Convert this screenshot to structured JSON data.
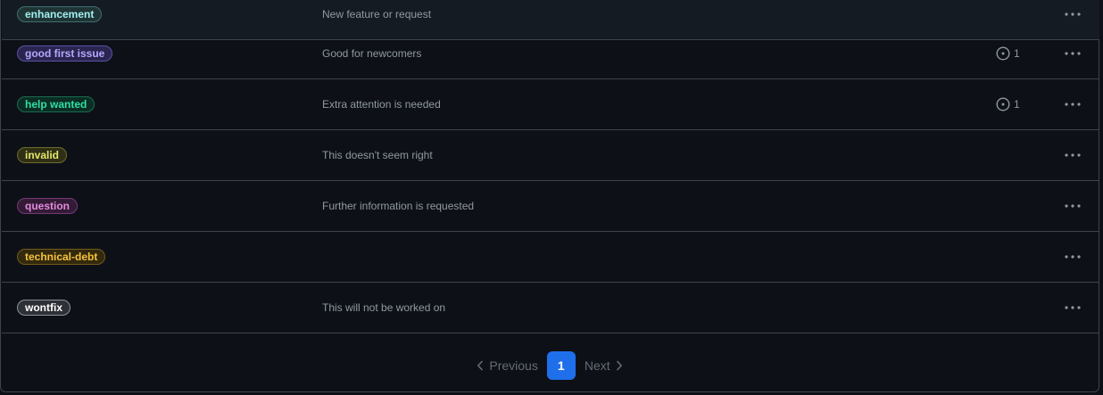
{
  "labels": [
    {
      "name": "enhancement",
      "description": "New feature or request",
      "issues": "",
      "color": "#a2eeef",
      "bg": "#1f3435",
      "border": "#3e6e70"
    },
    {
      "name": "good first issue",
      "description": "Good for newcomers",
      "issues": "1",
      "color": "#b5a7ff",
      "bg": "#2a2550",
      "border": "#5c50a8"
    },
    {
      "name": "help wanted",
      "description": "Extra attention is needed",
      "issues": "1",
      "color": "#2ee0a6",
      "bg": "#0b2d23",
      "border": "#1b6b51"
    },
    {
      "name": "invalid",
      "description": "This doesn't seem right",
      "issues": "",
      "color": "#e4e669",
      "bg": "#302f16",
      "border": "#6d6b2c"
    },
    {
      "name": "question",
      "description": "Further information is requested",
      "issues": "",
      "color": "#e48bde",
      "bg": "#331b35",
      "border": "#74387a"
    },
    {
      "name": "technical-debt",
      "description": "",
      "issues": "",
      "color": "#f5c33b",
      "bg": "#33290d",
      "border": "#735a17"
    },
    {
      "name": "wontfix",
      "description": "This will not be worked on",
      "issues": "",
      "color": "#ffffff",
      "bg": "#2d3036",
      "border": "#8b929b"
    }
  ],
  "pagination": {
    "previous": "Previous",
    "current": "1",
    "next": "Next"
  }
}
